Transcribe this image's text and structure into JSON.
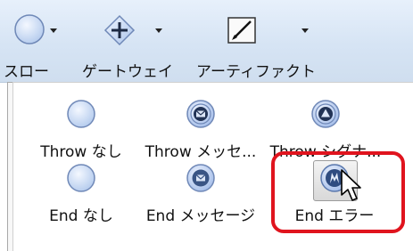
{
  "ribbon": {
    "buttons": [
      {
        "label": "スロー",
        "icon": "circle-event-icon"
      },
      {
        "label": "ゲートウェイ",
        "icon": "gateway-diamond-plus-icon"
      },
      {
        "label": "アーティファクト",
        "icon": "artifact-pencil-icon"
      }
    ]
  },
  "gallery": {
    "items": [
      {
        "label": "Throw なし",
        "icon": "throw-none-circle-icon"
      },
      {
        "label": "Throw メッセ...",
        "icon": "throw-message-icon"
      },
      {
        "label": "Throw シグナ...",
        "icon": "throw-signal-icon"
      },
      {
        "label": "End なし",
        "icon": "end-none-circle-icon"
      },
      {
        "label": "End メッセージ",
        "icon": "end-message-icon"
      },
      {
        "label": "End エラー",
        "icon": "end-error-icon"
      }
    ],
    "highlight_color": "#e0141e"
  }
}
